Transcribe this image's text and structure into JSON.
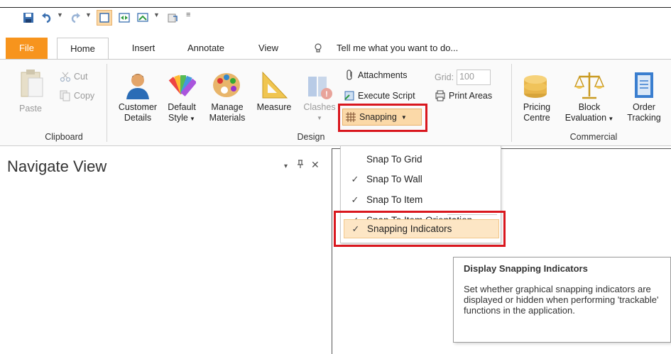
{
  "quick_access": {
    "icons": [
      "save-icon",
      "undo-icon",
      "redo-icon",
      "view-icon",
      "layout-icon",
      "screen-icon",
      "export-icon",
      "customize-icon"
    ]
  },
  "tabs": [
    {
      "label": "File"
    },
    {
      "label": "Home"
    },
    {
      "label": "Insert"
    },
    {
      "label": "Annotate"
    },
    {
      "label": "View"
    }
  ],
  "tell_me": {
    "placeholder": "Tell me what you want to do..."
  },
  "ribbon": {
    "clipboard": {
      "paste": "Paste",
      "cut": "Cut",
      "copy": "Copy",
      "group_label": "Clipboard"
    },
    "design": {
      "customer_details": [
        "Customer",
        "Details"
      ],
      "default_style": [
        "Default",
        "Style"
      ],
      "manage_materials": [
        "Manage",
        "Materials"
      ],
      "measure": "Measure",
      "clashes": "Clashes",
      "attachments": "Attachments",
      "grid_label": "Grid:",
      "grid_value": "100",
      "execute_script": "Execute Script",
      "print_areas": "Print Areas",
      "snapping": "Snapping",
      "group_label": "Design"
    },
    "commercial": {
      "pricing_centre": [
        "Pricing",
        "Centre"
      ],
      "block_evaluation": [
        "Block",
        "Evaluation"
      ],
      "order_tracking": [
        "Order",
        "Tracking"
      ],
      "group_label": "Commercial"
    }
  },
  "navigate": {
    "title": "Navigate View",
    "dropdown": "▾",
    "pin": "ᵖ",
    "close": "✕"
  },
  "snapping_menu": {
    "items": [
      {
        "label": "Snap To Grid",
        "checked": false
      },
      {
        "label": "Snap To Wall",
        "checked": true
      },
      {
        "label": "Snap To Item",
        "checked": true
      },
      {
        "label": "Snap To Item Orientation",
        "checked": true
      },
      {
        "label": "Snapping Indicators",
        "checked": true
      }
    ],
    "check_glyph": "✓"
  },
  "tooltip": {
    "title": "Display Snapping Indicators",
    "body": "Set whether graphical snapping indicators are displayed or hidden when performing 'trackable' functions in the application."
  },
  "colors": {
    "file_tab": "#f7941d",
    "highlight_box": "#d9171e",
    "menu_highlight": "#fde6c5"
  }
}
